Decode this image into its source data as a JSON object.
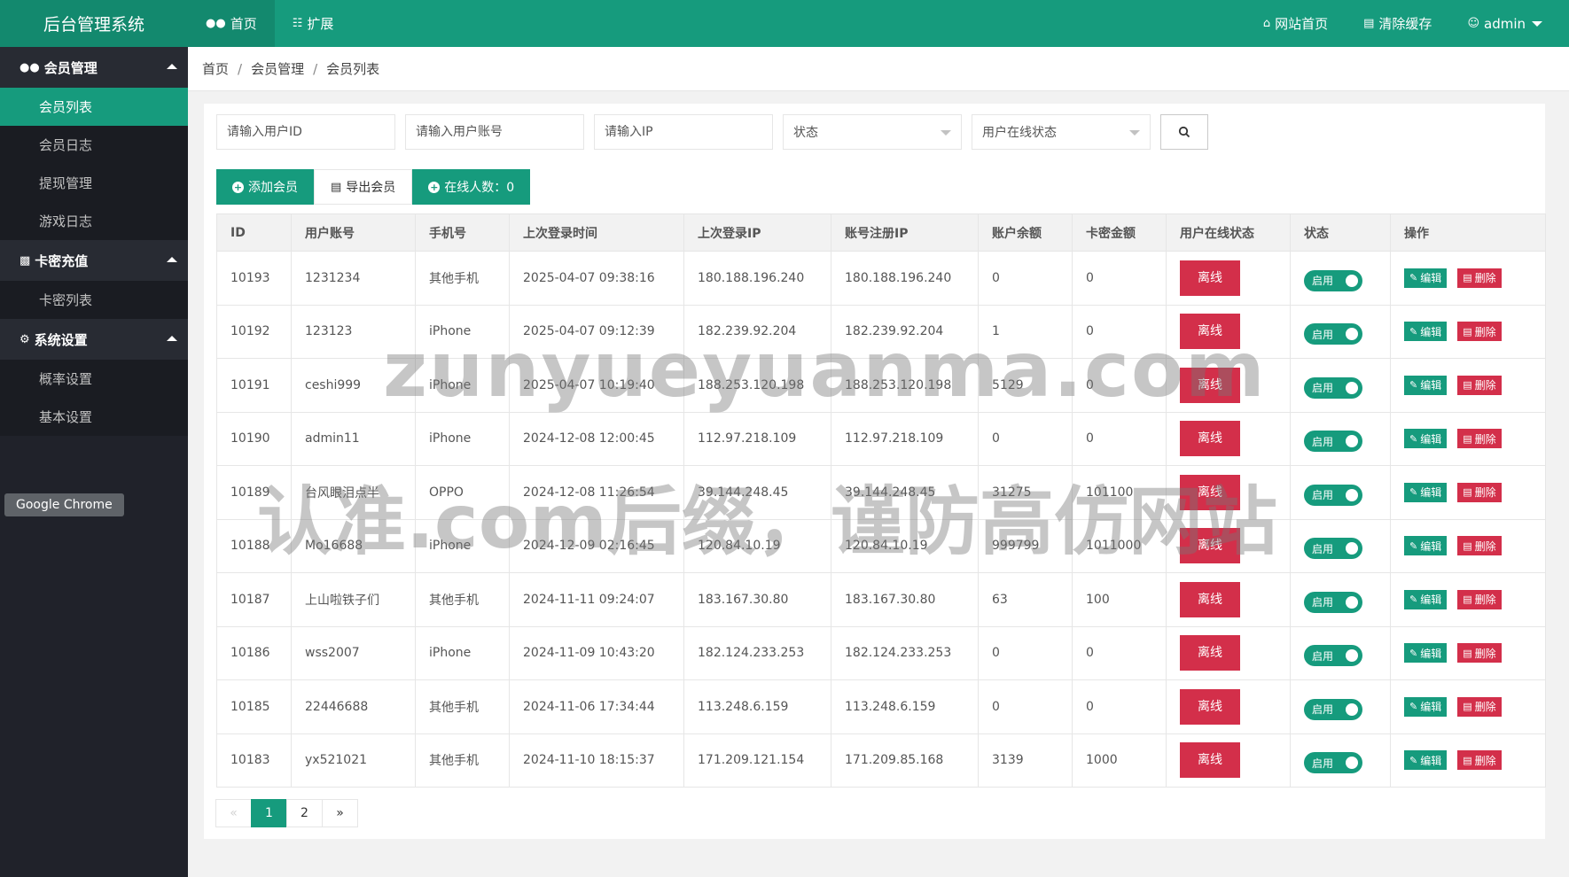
{
  "app": {
    "title": "后台管理系统"
  },
  "topnav": [
    {
      "icon": "users-icon",
      "label": "首页",
      "active": true
    },
    {
      "icon": "sitemap-icon",
      "label": "扩展",
      "active": false
    }
  ],
  "topright": {
    "site_home": "网站首页",
    "clear_cache": "清除缓存",
    "user": "admin"
  },
  "sidebar": {
    "groups": [
      {
        "label": "会员管理",
        "icon": "users-icon",
        "items": [
          {
            "label": "会员列表",
            "active": true
          },
          {
            "label": "会员日志",
            "active": false
          },
          {
            "label": "提现管理",
            "active": false
          },
          {
            "label": "游戏日志",
            "active": false
          }
        ]
      },
      {
        "label": "卡密充值",
        "icon": "card-icon",
        "items": [
          {
            "label": "卡密列表",
            "active": false
          }
        ]
      },
      {
        "label": "系统设置",
        "icon": "gear-icon",
        "items": [
          {
            "label": "概率设置",
            "active": false
          },
          {
            "label": "基本设置",
            "active": false
          }
        ]
      }
    ],
    "tooltip": "Google Chrome"
  },
  "breadcrumb": [
    "首页",
    "会员管理",
    "会员列表"
  ],
  "filters": {
    "user_id_placeholder": "请输入用户ID",
    "account_placeholder": "请输入用户账号",
    "ip_placeholder": "请输入IP",
    "status_select": "状态",
    "online_select": "用户在线状态"
  },
  "actions": {
    "add": "添加会员",
    "export": "导出会员",
    "online_count": "在线人数：0"
  },
  "table": {
    "columns": [
      "ID",
      "用户账号",
      "手机号",
      "上次登录时间",
      "上次登录IP",
      "账号注册IP",
      "账户余额",
      "卡密金额",
      "用户在线状态",
      "状态",
      "操作"
    ],
    "offline_label": "离线",
    "enabled_label": "启用",
    "edit_label": "编辑",
    "delete_label": "删除",
    "rows": [
      [
        "10193",
        "1231234",
        "其他手机",
        "2025-04-07 09:38:16",
        "180.188.196.240",
        "180.188.196.240",
        "0",
        "0"
      ],
      [
        "10192",
        "123123",
        "iPhone",
        "2025-04-07 09:12:39",
        "182.239.92.204",
        "182.239.92.204",
        "1",
        "0"
      ],
      [
        "10191",
        "ceshi999",
        "iPhone",
        "2025-04-07 10:19:40",
        "188.253.120.198",
        "188.253.120.198",
        "5129",
        "0"
      ],
      [
        "10190",
        "admin11",
        "iPhone",
        "2024-12-08 12:00:45",
        "112.97.218.109",
        "112.97.218.109",
        "0",
        "0"
      ],
      [
        "10189",
        "台风眼泪点半",
        "OPPO",
        "2024-12-08 11:26:54",
        "39.144.248.45",
        "39.144.248.45",
        "31275",
        "101100"
      ],
      [
        "10188",
        "Mo16688",
        "iPhone",
        "2024-12-09 02:16:45",
        "120.84.10.19",
        "120.84.10.19",
        "999799",
        "1011000"
      ],
      [
        "10187",
        "上山啦铁子们",
        "其他手机",
        "2024-11-11 09:24:07",
        "183.167.30.80",
        "183.167.30.80",
        "63",
        "100"
      ],
      [
        "10186",
        "wss2007",
        "iPhone",
        "2024-11-09 10:43:20",
        "182.124.233.253",
        "182.124.233.253",
        "0",
        "0"
      ],
      [
        "10185",
        "22446688",
        "其他手机",
        "2024-11-06 17:34:44",
        "113.248.6.159",
        "113.248.6.159",
        "0",
        "0"
      ],
      [
        "10183",
        "yx521021",
        "其他手机",
        "2024-11-10 18:15:37",
        "171.209.121.154",
        "171.209.85.168",
        "3139",
        "1000"
      ]
    ]
  },
  "pager": {
    "prev": "«",
    "pages": [
      "1",
      "2"
    ],
    "current": "1",
    "next": "»"
  },
  "watermark": {
    "line1": "zunyueyuanma.com",
    "line2": "认准.com后缀，谨防高仿网站"
  },
  "colors": {
    "primary": "#169b7d",
    "danger": "#d32f4a",
    "sidebar": "#20222a"
  }
}
